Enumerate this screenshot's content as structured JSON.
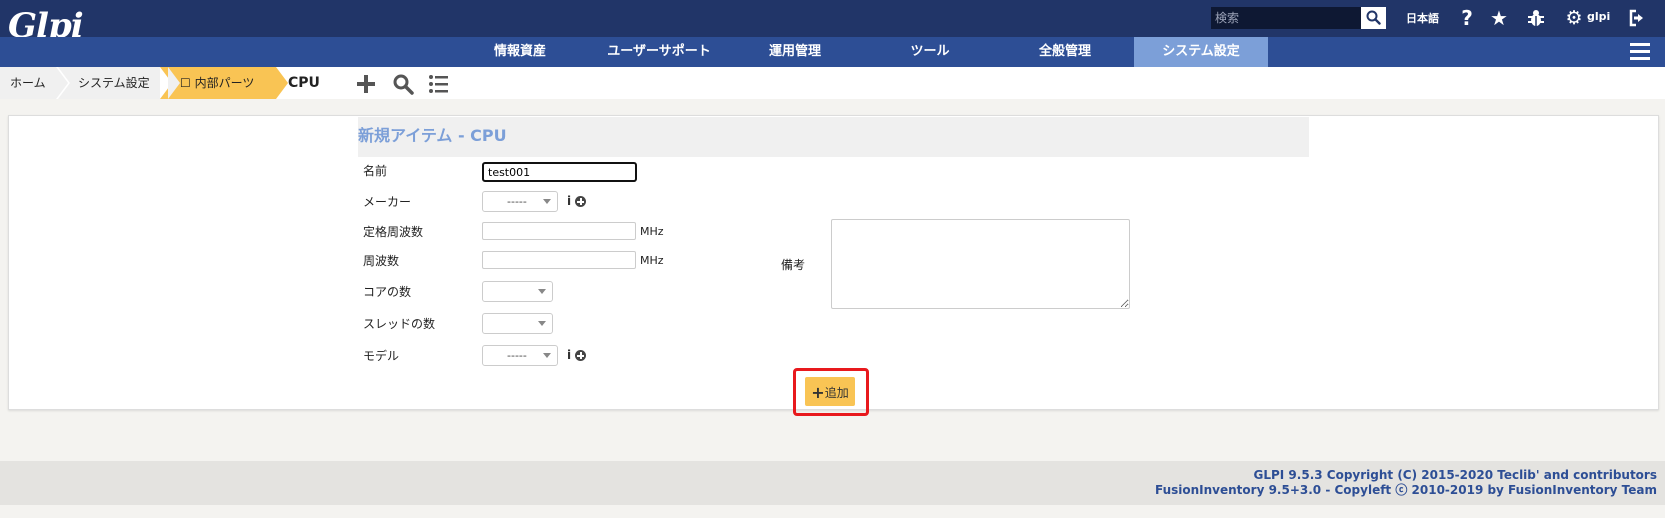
{
  "app": {
    "logo_text": "Glpi"
  },
  "topbar": {
    "search_placeholder": "検索",
    "language": "日本語",
    "username": "glpi",
    "icons": [
      "search-icon",
      "help-icon",
      "star-icon",
      "bug-icon",
      "gear-icon",
      "logout-icon"
    ]
  },
  "menu": {
    "items": [
      {
        "label": "情報資産"
      },
      {
        "label": "ユーザーサポート"
      },
      {
        "label": "運用管理"
      },
      {
        "label": "ツール"
      },
      {
        "label": "全般管理"
      },
      {
        "label": "システム設定",
        "active": true
      }
    ]
  },
  "breadcrumb": {
    "items": [
      {
        "label": "ホーム"
      },
      {
        "label": "システム設定"
      },
      {
        "label": "☐ 内部パーツ"
      }
    ],
    "current": "CPU",
    "tool_icons": [
      "add-icon",
      "search-icon",
      "list-icon"
    ]
  },
  "form": {
    "title": "新規アイテム - CPU",
    "fields": {
      "name": {
        "label": "名前",
        "value": "test001"
      },
      "manufacturer": {
        "label": "メーカー",
        "value": "-----"
      },
      "nominal_freq": {
        "label": "定格周波数",
        "unit": "MHz",
        "value": ""
      },
      "frequency": {
        "label": "周波数",
        "unit": "MHz",
        "value": ""
      },
      "cores": {
        "label": "コアの数",
        "value": ""
      },
      "threads": {
        "label": "スレッドの数",
        "value": ""
      },
      "model": {
        "label": "モデル",
        "value": "-----"
      }
    },
    "info_icon_text": "i",
    "comment_label": "備考",
    "add_button": "追加",
    "accent_color": "#7c9fd8",
    "button_color": "#f9c454",
    "highlight_color": "#e8191d"
  },
  "footer": {
    "line1": "GLPI 9.5.3 Copyright (C) 2015-2020 Teclib' and contributors",
    "line2": "FusionInventory 9.5+3.0 - Copyleft ⓒ 2010-2019 by FusionInventory Team"
  }
}
